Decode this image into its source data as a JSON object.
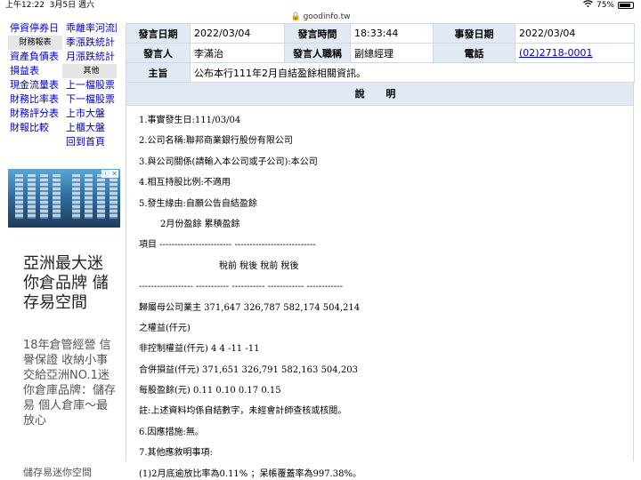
{
  "status_bar": {
    "time": "上午12:22",
    "date": "3月5日 週六",
    "battery": "75%"
  },
  "address_bar": {
    "domain": "goodinfo.tw"
  },
  "sidebar": {
    "rows": [
      {
        "left": "停資停券日",
        "right": "乖離率河流圖"
      },
      {
        "left": "財務報表",
        "right": "季漲跌統計",
        "left_head": true
      },
      {
        "left": "資產負債表",
        "right": "月漲跌統計"
      },
      {
        "left": "損益表",
        "right": "其他",
        "right_head": true
      },
      {
        "left": "現金流量表",
        "right": "上一檔股票"
      },
      {
        "left": "財務比率表",
        "right": "下一檔股票"
      },
      {
        "left": "財務評分表",
        "right": "上市大盤"
      },
      {
        "left": "財報比較",
        "right": "上櫃大盤"
      },
      {
        "left": "",
        "right": "回到首頁"
      }
    ]
  },
  "ad": {
    "badge": "ⓘ ✕",
    "title": "亞洲最大迷你倉品牌 儲存易空間",
    "description": "18年倉管經營 信譽保證 收納小事交給亞洲NO.1迷你倉庫品牌：儲存易 個人倉庫～最放心",
    "footer": "儲存易迷你空間"
  },
  "announcement": {
    "labels": {
      "announce_date": "發言日期",
      "announce_time": "發言時間",
      "event_date": "事發日期",
      "speaker": "發言人",
      "speaker_title": "發言人職稱",
      "phone": "電話",
      "subject": "主旨",
      "description": "說 明"
    },
    "announce_date": "2022/03/04",
    "announce_time": "18:33:44",
    "event_date": "2022/03/04",
    "speaker": "李滿治",
    "speaker_title": "副總經理",
    "phone": "(02)2718-0001",
    "subject": "公布本行111年2月自結盈餘相關資訊。",
    "lines": [
      "1.事實發生日:111/03/04",
      "2.公司名稱:聯邦商業銀行股份有限公司",
      "3.與公司關係(請輸入本公司或子公司):本公司",
      "4.相互持股比例:不適用",
      "5.發生緣由:自願公告自結盈餘",
      "2月份盈餘 累積盈餘",
      "項目 ------------------------ ---------------------------",
      "稅前 稅後 稅前 稅後",
      "------------------ ----------- ----------- ------------ ------------",
      "歸屬母公司業主 371,647 326,787 582,174 504,214",
      "之權益(仟元)",
      "非控制權益(仟元) 4 4 -11 -11",
      "合併損益(仟元) 371,651 326,791 582,163 504,203",
      "每股盈餘(元) 0.11 0.10 0.17 0.15",
      "註:上述資料均係自結數字，未經會計師查核或核閱。",
      "6.因應措施:無。",
      "7.其他應敘明事項:",
      "(1)2月底逾放比率為0.11% ；呆帳覆蓋率為997.38%。"
    ]
  }
}
